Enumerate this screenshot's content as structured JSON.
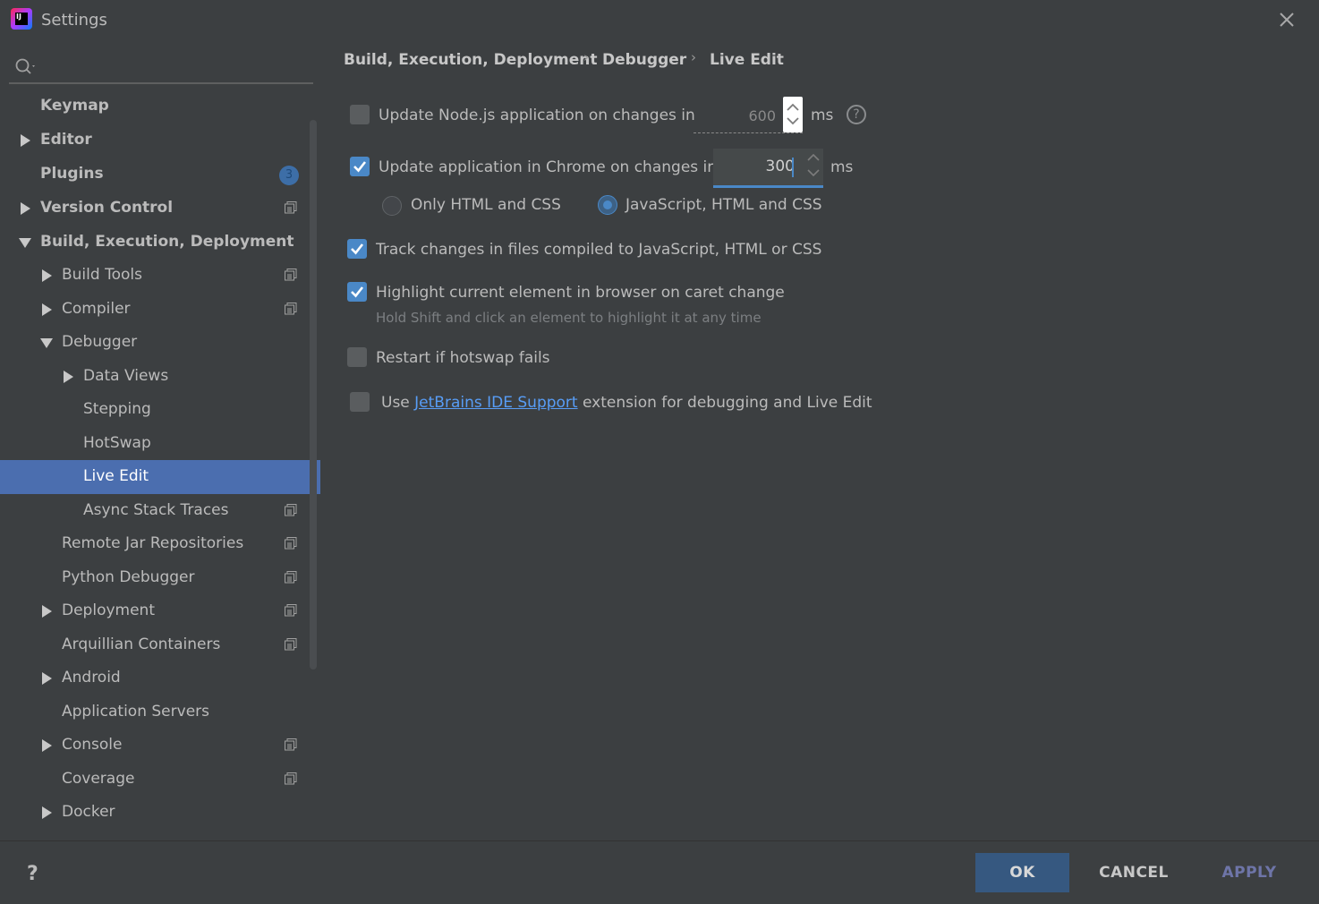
{
  "window": {
    "title": "Settings",
    "app_icon_text": "IJ"
  },
  "search": {
    "placeholder": "",
    "value": ""
  },
  "sidebar": {
    "items": [
      {
        "label": "Keymap"
      },
      {
        "label": "Editor"
      },
      {
        "label": "Plugins",
        "badge": "3"
      },
      {
        "label": "Version Control"
      },
      {
        "label": "Build, Execution, Deployment"
      },
      {
        "label": "Build Tools"
      },
      {
        "label": "Compiler"
      },
      {
        "label": "Debugger"
      },
      {
        "label": "Data Views"
      },
      {
        "label": "Stepping"
      },
      {
        "label": "HotSwap"
      },
      {
        "label": "Live Edit"
      },
      {
        "label": "Async Stack Traces"
      },
      {
        "label": "Remote Jar Repositories"
      },
      {
        "label": "Python Debugger"
      },
      {
        "label": "Deployment"
      },
      {
        "label": "Arquillian Containers"
      },
      {
        "label": "Android"
      },
      {
        "label": "Application Servers"
      },
      {
        "label": "Console"
      },
      {
        "label": "Coverage"
      },
      {
        "label": "Docker"
      }
    ]
  },
  "breadcrumb": {
    "items": [
      "Build, Execution, Deployment",
      "Debugger",
      "Live Edit"
    ],
    "separator": "›"
  },
  "settings": {
    "node_update": {
      "label": "Update Node.js application on changes in",
      "checked": false,
      "value": "600",
      "unit": "ms"
    },
    "chrome_update": {
      "label": "Update application in Chrome on changes in",
      "checked": true,
      "value": "300",
      "unit": "ms"
    },
    "radio_only_html": {
      "label": "Only HTML and CSS",
      "selected": false
    },
    "radio_js_html": {
      "label": "JavaScript, HTML and CSS",
      "selected": true
    },
    "track_changes": {
      "label": "Track changes in files compiled to JavaScript, HTML or CSS",
      "checked": true
    },
    "highlight_element": {
      "label": "Highlight current element in browser on caret change",
      "checked": true,
      "hint": "Hold Shift and click an element to highlight it at any time"
    },
    "restart_hotswap": {
      "label": "Restart if hotswap fails",
      "checked": false
    },
    "jetbrains_ext": {
      "prefix": "Use",
      "link": "JetBrains IDE Support",
      "suffix": "extension for debugging and Live Edit",
      "checked": false
    }
  },
  "footer": {
    "help": "?",
    "ok": "OK",
    "cancel": "CANCEL",
    "apply": "APPLY"
  },
  "colors": {
    "background": "#3c3f41",
    "selection": "#4b6eaf",
    "accent": "#4a88c7",
    "link": "#589df6",
    "ok_button": "#365880"
  }
}
